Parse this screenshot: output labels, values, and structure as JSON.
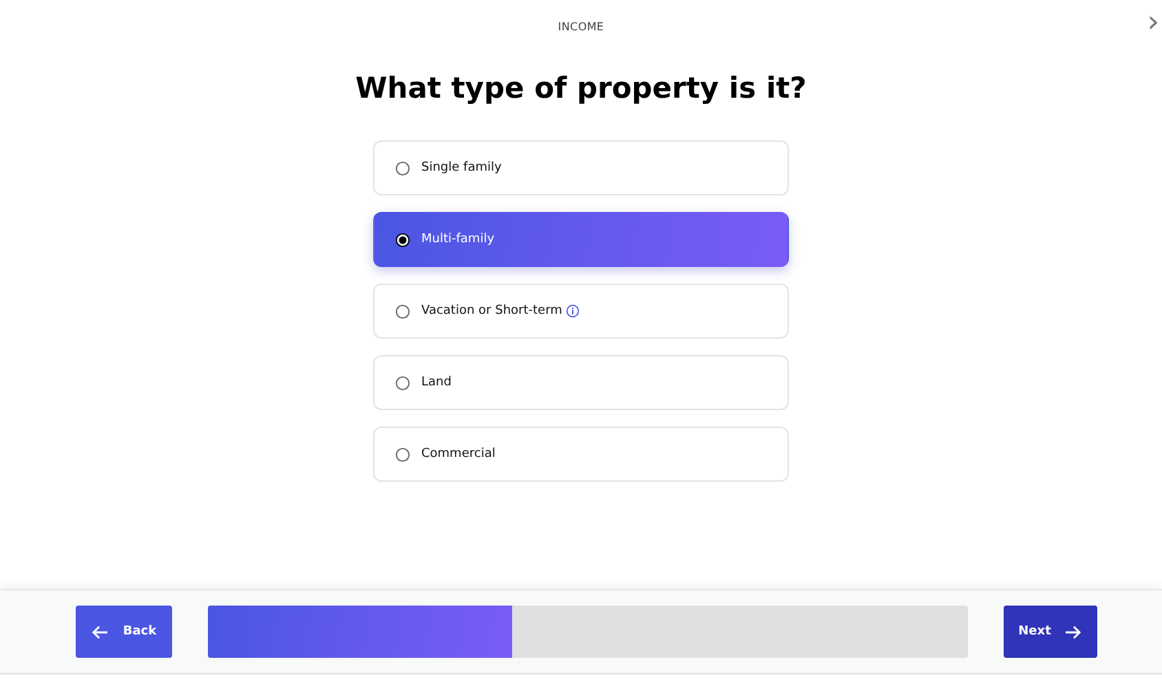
{
  "header": {
    "section": "INCOME",
    "forward": "›"
  },
  "question": "What type of property is it?",
  "options": [
    {
      "label": "Single family",
      "selected": false,
      "info": false
    },
    {
      "label": "Multi-family",
      "selected": true,
      "info": false
    },
    {
      "label": "Vacation or Short-term",
      "selected": false,
      "info": true
    },
    {
      "label": "Land",
      "selected": false,
      "info": false
    },
    {
      "label": "Commercial",
      "selected": false,
      "info": false
    }
  ],
  "footer": {
    "back": "Back",
    "next": "Next",
    "progress": {
      "level": 0.4
    }
  }
}
